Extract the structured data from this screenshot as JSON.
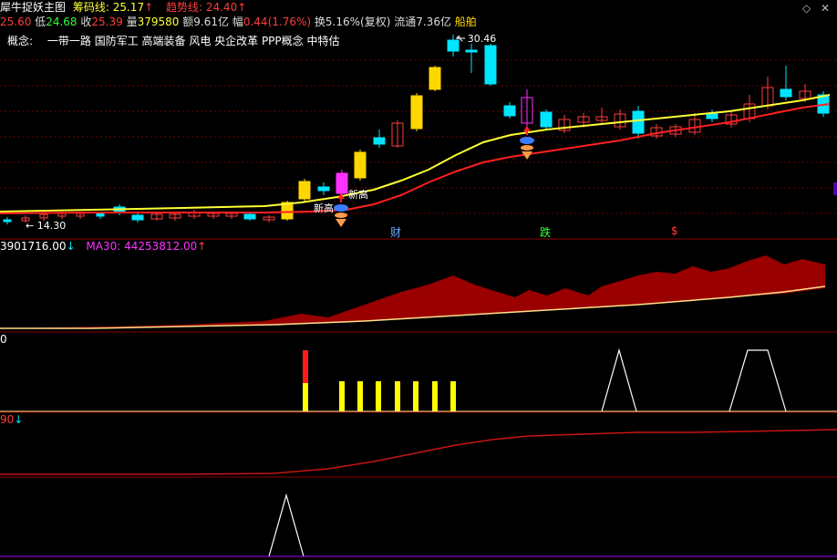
{
  "header": {
    "title": "犀牛捉妖主图",
    "chip_label": "筹码线:",
    "chip_value": "25.17",
    "chip_arrow": "↑",
    "trend_label": "趋势线:",
    "trend_value": "24.40",
    "trend_arrow": "↑"
  },
  "quote": {
    "open_fragment": "25.60",
    "low_label": "低",
    "low_value": "24.68",
    "close_label": "收",
    "close_value": "25.39",
    "volume_label": "量",
    "volume_value": "379580",
    "amount_label": "额",
    "amount_value": "9.61亿",
    "change_label": "幅",
    "change_value": "0.44(1.76%)",
    "turnover_label": "换",
    "turnover_value": "5.16%(复权)",
    "float_label": "流通",
    "float_value": "7.36亿",
    "sector": "船舶"
  },
  "concept": {
    "label": "概念:",
    "items": "一带一路 国防军工 高端装备 风电 央企改革 PPP概念 中特估"
  },
  "annotations": {
    "low_price": "14.30",
    "high_price": "30.46",
    "new_high_1": "新高",
    "new_high_2": "新高",
    "marker_cai": "财",
    "marker_die": "跌",
    "marker_dollar": "$"
  },
  "panel2": {
    "value_fragment": "3901716.00",
    "value_arrow": "↓",
    "ma_label": "MA30:",
    "ma_value": "44253812.00",
    "ma_arrow": "↑"
  },
  "panel3": {
    "label": "0"
  },
  "panel4": {
    "value_fragment": "90",
    "value_arrow": "↓"
  },
  "window_controls": {
    "restore": "◇",
    "close": "✕"
  },
  "colors": {
    "background": "#000000",
    "up_candle": "#ff3c3c",
    "down_candle": "#00e5ff",
    "signal_candle_yellow": "#ffd700",
    "signal_candle_magenta": "#ff33ff",
    "chip_line": "#ffff33",
    "trend_line": "#ff2020",
    "volume_fill": "#9a0000",
    "label_blue": "#6ea8ff",
    "label_green": "#33ff33"
  }
}
